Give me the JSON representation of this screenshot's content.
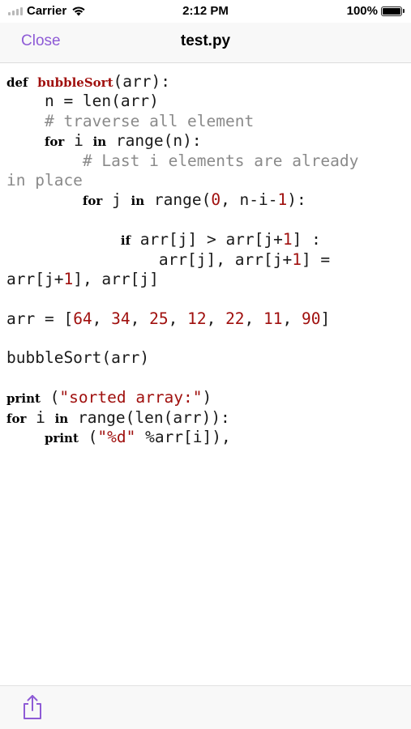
{
  "status_bar": {
    "carrier": "Carrier",
    "time": "2:12 PM",
    "battery": "100%",
    "battery_level": 1.0
  },
  "nav": {
    "close_label": "Close",
    "title": "test.py"
  },
  "accent_color": "#8e5bd6",
  "code_lines": [
    [
      {
        "t": "def",
        "c": "kw"
      },
      {
        "t": " ",
        "c": ""
      },
      {
        "t": "bubbleSort",
        "c": "fn"
      },
      {
        "t": "(arr):",
        "c": ""
      }
    ],
    [
      {
        "t": "    n = len(arr)",
        "c": ""
      }
    ],
    [
      {
        "t": "    # traverse all element",
        "c": "cmt"
      }
    ],
    [
      {
        "t": "    ",
        "c": ""
      },
      {
        "t": "for",
        "c": "kw"
      },
      {
        "t": " i ",
        "c": ""
      },
      {
        "t": "in",
        "c": "kw"
      },
      {
        "t": " range(n):",
        "c": ""
      }
    ],
    [
      {
        "t": "        # Last i elements are already",
        "c": "cmt"
      }
    ],
    [
      {
        "t": "in place",
        "c": "cmt"
      }
    ],
    [
      {
        "t": "        ",
        "c": ""
      },
      {
        "t": "for",
        "c": "kw"
      },
      {
        "t": " j ",
        "c": ""
      },
      {
        "t": "in",
        "c": "kw"
      },
      {
        "t": " range(",
        "c": ""
      },
      {
        "t": "0",
        "c": "num"
      },
      {
        "t": ", n-i-",
        "c": ""
      },
      {
        "t": "1",
        "c": "num"
      },
      {
        "t": "):",
        "c": ""
      }
    ],
    [
      {
        "t": "",
        "c": ""
      }
    ],
    [
      {
        "t": "            ",
        "c": ""
      },
      {
        "t": "if",
        "c": "kw"
      },
      {
        "t": " arr[j] > arr[j+",
        "c": ""
      },
      {
        "t": "1",
        "c": "num"
      },
      {
        "t": "] :",
        "c": ""
      }
    ],
    [
      {
        "t": "                arr[j], arr[j+",
        "c": ""
      },
      {
        "t": "1",
        "c": "num"
      },
      {
        "t": "] =",
        "c": ""
      }
    ],
    [
      {
        "t": "arr[j+",
        "c": ""
      },
      {
        "t": "1",
        "c": "num"
      },
      {
        "t": "], arr[j]",
        "c": ""
      }
    ],
    [
      {
        "t": "",
        "c": ""
      }
    ],
    [
      {
        "t": "arr = [",
        "c": ""
      },
      {
        "t": "64",
        "c": "num"
      },
      {
        "t": ", ",
        "c": ""
      },
      {
        "t": "34",
        "c": "num"
      },
      {
        "t": ", ",
        "c": ""
      },
      {
        "t": "25",
        "c": "num"
      },
      {
        "t": ", ",
        "c": ""
      },
      {
        "t": "12",
        "c": "num"
      },
      {
        "t": ", ",
        "c": ""
      },
      {
        "t": "22",
        "c": "num"
      },
      {
        "t": ", ",
        "c": ""
      },
      {
        "t": "11",
        "c": "num"
      },
      {
        "t": ", ",
        "c": ""
      },
      {
        "t": "90",
        "c": "num"
      },
      {
        "t": "]",
        "c": ""
      }
    ],
    [
      {
        "t": "",
        "c": ""
      }
    ],
    [
      {
        "t": "bubbleSort(arr)",
        "c": ""
      }
    ],
    [
      {
        "t": "",
        "c": ""
      }
    ],
    [
      {
        "t": "print",
        "c": "kw"
      },
      {
        "t": " (",
        "c": ""
      },
      {
        "t": "\"sorted array:\"",
        "c": "str"
      },
      {
        "t": ")",
        "c": ""
      }
    ],
    [
      {
        "t": "for",
        "c": "kw"
      },
      {
        "t": " i ",
        "c": ""
      },
      {
        "t": "in",
        "c": "kw"
      },
      {
        "t": " range(len(arr)):",
        "c": ""
      }
    ],
    [
      {
        "t": "    ",
        "c": ""
      },
      {
        "t": "print",
        "c": "kw"
      },
      {
        "t": " (",
        "c": ""
      },
      {
        "t": "\"%d\"",
        "c": "str"
      },
      {
        "t": " %arr[i]),",
        "c": ""
      }
    ]
  ],
  "toolbar": {
    "share_icon": "share-icon"
  }
}
